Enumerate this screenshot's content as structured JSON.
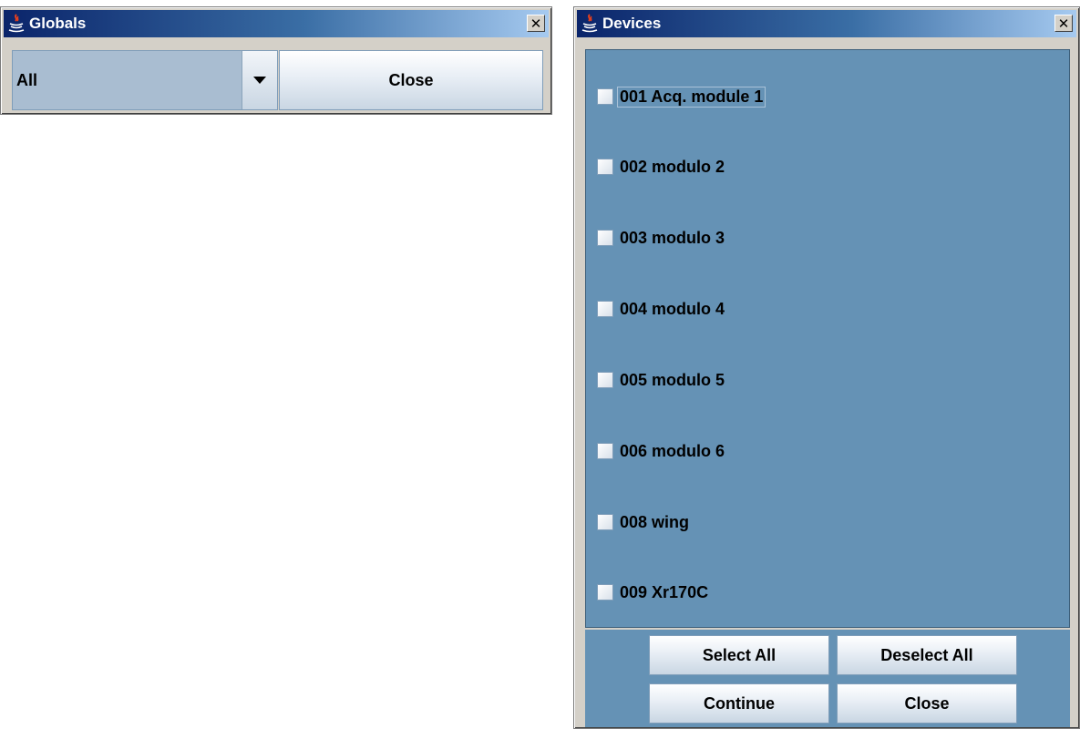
{
  "globals_window": {
    "title": "Globals",
    "close_x": "✕",
    "combo_value": "All",
    "close_label": "Close"
  },
  "devices_window": {
    "title": "Devices",
    "close_x": "✕",
    "items": [
      {
        "label": "001 Acq. module 1",
        "checked": false,
        "focused": true
      },
      {
        "label": "002 modulo 2",
        "checked": false
      },
      {
        "label": "003 modulo 3",
        "checked": false
      },
      {
        "label": "004 modulo 4",
        "checked": false
      },
      {
        "label": "005 modulo 5",
        "checked": false
      },
      {
        "label": "006 modulo 6",
        "checked": false
      },
      {
        "label": "008 wing",
        "checked": false
      },
      {
        "label": "009 Xr170C",
        "checked": false
      }
    ],
    "buttons": {
      "select_all": "Select All",
      "deselect_all": "Deselect All",
      "continue": "Continue",
      "close": "Close"
    }
  },
  "colors": {
    "list_background": "#6592b5",
    "title_gradient_start": "#0a246a",
    "title_gradient_end": "#a6caf0"
  },
  "icons": [
    "java-coffee-icon",
    "close-icon",
    "chevron-down-icon"
  ]
}
